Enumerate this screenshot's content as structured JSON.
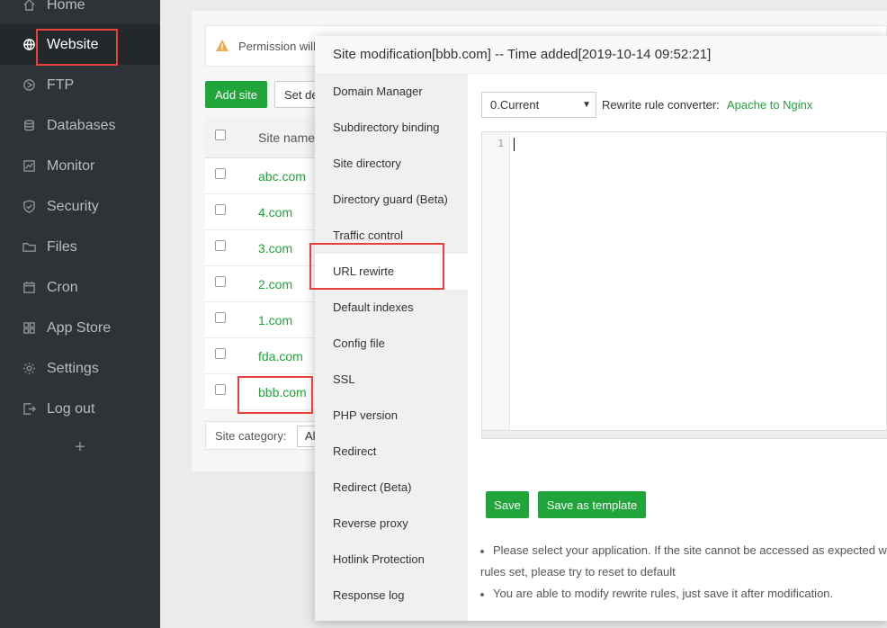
{
  "sidebar": {
    "items": [
      {
        "label": "Home",
        "icon": "home-icon"
      },
      {
        "label": "Website",
        "icon": "globe-icon"
      },
      {
        "label": "FTP",
        "icon": "ftp-icon"
      },
      {
        "label": "Databases",
        "icon": "database-icon"
      },
      {
        "label": "Monitor",
        "icon": "monitor-icon"
      },
      {
        "label": "Security",
        "icon": "shield-icon"
      },
      {
        "label": "Files",
        "icon": "folder-icon"
      },
      {
        "label": "Cron",
        "icon": "calendar-icon"
      },
      {
        "label": "App Store",
        "icon": "grid-icon"
      },
      {
        "label": "Settings",
        "icon": "gear-icon"
      },
      {
        "label": "Log out",
        "icon": "logout-icon"
      }
    ],
    "active": "Website",
    "add_label": "+"
  },
  "main": {
    "warning_text": "Permission will",
    "add_site_label": "Add site",
    "set_default_label": "Set de",
    "table_header": "Site name",
    "sites": [
      "abc.com",
      "4.com",
      "3.com",
      "2.com",
      "1.com",
      "fda.com",
      "bbb.com"
    ],
    "category_label": "Site category:",
    "category_value": "Al"
  },
  "modal": {
    "title": "Site modification[bbb.com] -- Time added[2019-10-14 09:52:21]",
    "menu": [
      "Domain Manager",
      "Subdirectory binding",
      "Site directory",
      "Directory guard (Beta)",
      "Traffic control",
      "URL rewirte",
      "Default indexes",
      "Config file",
      "SSL",
      "PHP version",
      "Redirect",
      "Redirect (Beta)",
      "Reverse proxy",
      "Hotlink Protection",
      "Response log"
    ],
    "active_menu": "URL rewirte",
    "version_select": "0.Current",
    "converter_label": "Rewrite rule converter:",
    "converter_link": "Apache to Nginx",
    "editor_line_number": "1",
    "save_label": "Save",
    "save_template_label": "Save as template",
    "tips": [
      "Please select your application. If the site cannot be accessed as expected wit",
      "rules set, please try to reset to default",
      "You are able to modify rewrite rules, just save it after modification."
    ]
  },
  "colors": {
    "accent": "#20a53a",
    "sidebar_bg": "#2f3337",
    "highlight": "#e8403a"
  }
}
